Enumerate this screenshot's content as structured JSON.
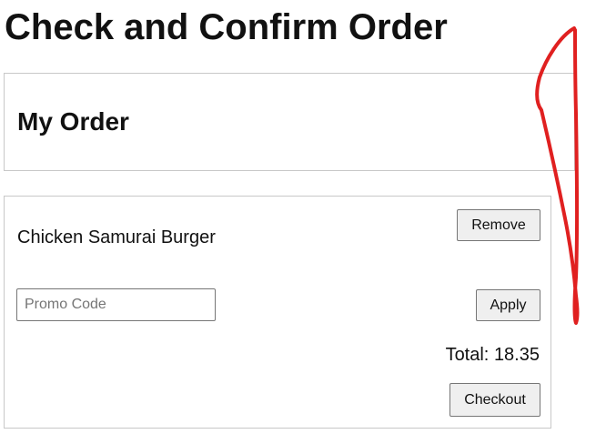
{
  "page": {
    "title": "Check and Confirm Order"
  },
  "order_header": {
    "title": "My Order"
  },
  "order": {
    "items": [
      {
        "name": "Chicken Samurai Burger",
        "remove_label": "Remove"
      }
    ],
    "promo": {
      "value": "",
      "placeholder": "Promo Code",
      "apply_label": "Apply"
    },
    "total": {
      "label": "Total:",
      "amount": "18.35"
    },
    "checkout_label": "Checkout"
  },
  "annotation": {
    "color": "#e02020"
  }
}
